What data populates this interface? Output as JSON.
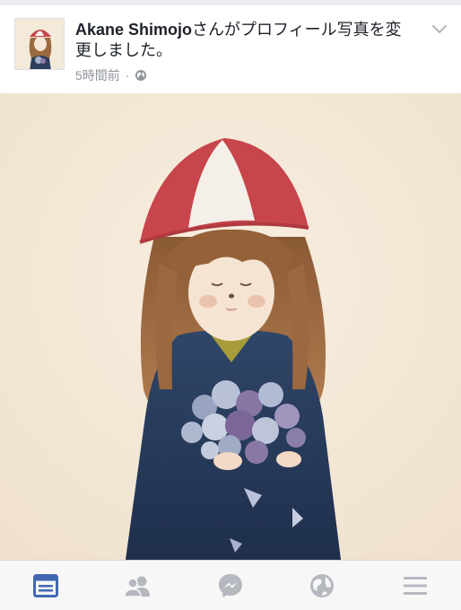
{
  "post": {
    "author": "Akane Shimojo",
    "action_text": "さんがプロフィール写真を変更しました。",
    "timestamp": "5時間前",
    "separator": "·",
    "privacy_icon": "globe-icon",
    "options_icon": "chevron-down-icon"
  },
  "photo": {
    "subject": "watercolor illustration"
  },
  "tabbar": {
    "tabs": [
      {
        "icon": "news-feed-icon",
        "active": true
      },
      {
        "icon": "friends-icon",
        "active": false
      },
      {
        "icon": "messenger-icon",
        "active": false
      },
      {
        "icon": "globe-icon",
        "active": false
      },
      {
        "icon": "menu-icon",
        "active": false
      }
    ]
  },
  "colors": {
    "accent": "#4267b2",
    "inactive_icon": "#b5b8be",
    "text": "#1d2129",
    "meta": "#90949c"
  }
}
